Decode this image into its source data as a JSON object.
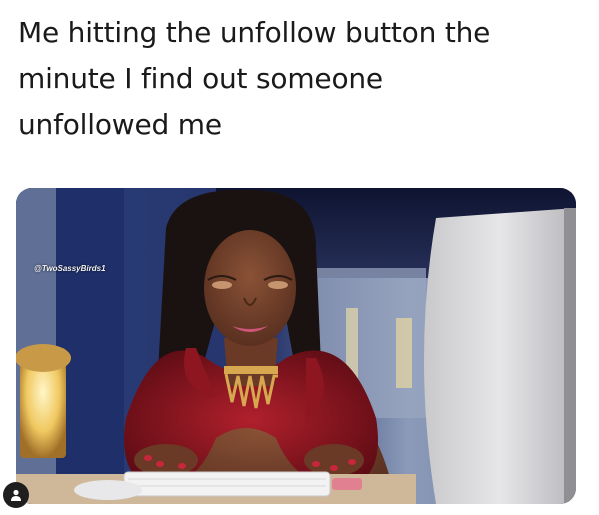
{
  "post": {
    "caption_lines": [
      "Me hitting the unfollow button the",
      "minute I find out someone",
      "unfollowed me"
    ],
    "watermark": "@TwoSassyBirds1"
  },
  "icons": {
    "user_tag": "user-tag-icon"
  },
  "colors": {
    "text": "#1a1a1a",
    "avatar_bg": "#1e1e1e"
  }
}
